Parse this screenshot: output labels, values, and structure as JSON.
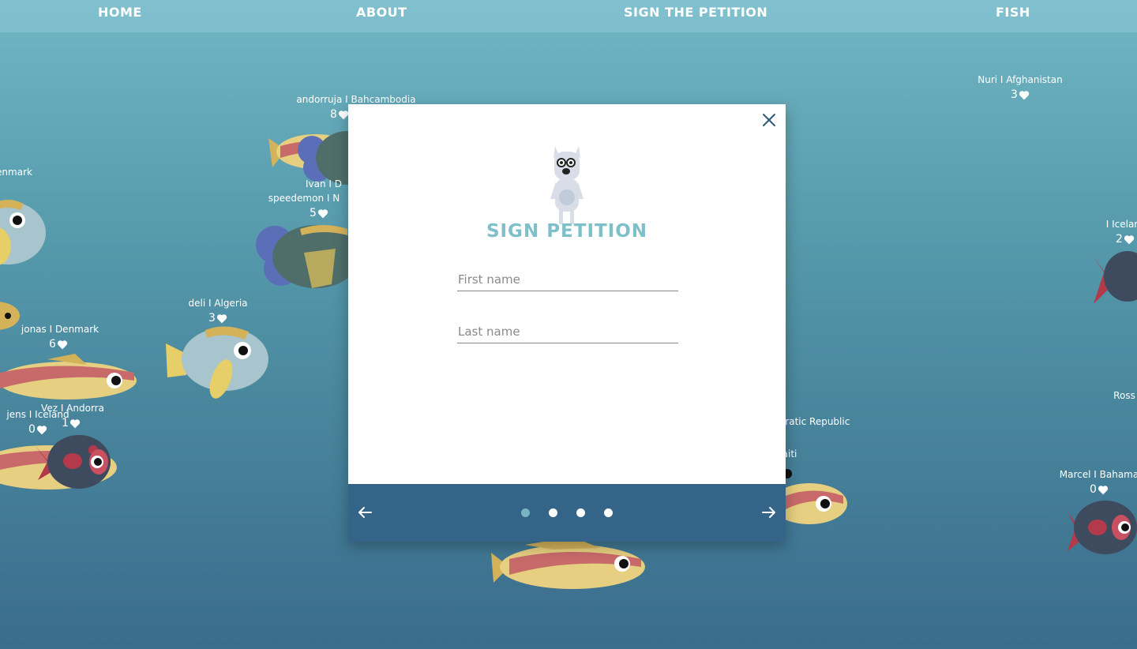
{
  "nav": {
    "items": [
      "HOME",
      "ABOUT",
      "SIGN THE PETITION",
      "FISH"
    ]
  },
  "fish_labels": [
    {
      "name": "Nuri I Afghanistan",
      "count": "3"
    },
    {
      "name": "enmark",
      "count": ""
    },
    {
      "name": "andorruja I Bahcambodia",
      "count": "8"
    },
    {
      "name": "Ivan I D",
      "count": ""
    },
    {
      "name": "speedemon I N",
      "count": "5"
    },
    {
      "name": "deli I Algeria",
      "count": "3"
    },
    {
      "name": "jonas I Denmark",
      "count": "6"
    },
    {
      "name": "Vez I Andorra",
      "count": "1"
    },
    {
      "name": "jens I Iceland",
      "count": "0"
    },
    {
      "name": "I Icelar",
      "count": "2"
    },
    {
      "name": "Ross",
      "count": ""
    },
    {
      "name": "cratic Republic",
      "count": ""
    },
    {
      "name": "aiti",
      "count": ""
    },
    {
      "name": "Marcel I Bahama",
      "count": "0"
    }
  ],
  "modal": {
    "title": "SIGN PETITION",
    "first_name_placeholder": "First name",
    "last_name_placeholder": "Last name",
    "first_name_value": "",
    "last_name_value": "",
    "steps": 4,
    "active_step": 1
  },
  "colors": {
    "accent": "#7ec0c9",
    "footer": "#346588",
    "nav_bg": "#8cc8d7"
  },
  "icons": [
    "close-icon",
    "arrow-left-icon",
    "arrow-right-icon",
    "heart-icon",
    "mascot-icon"
  ]
}
